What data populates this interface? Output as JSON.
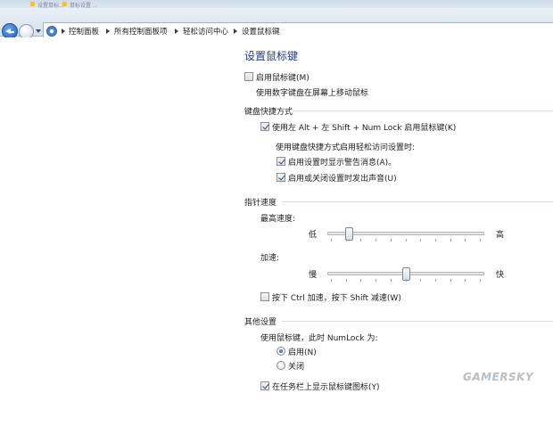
{
  "tabs_strip": [
    "设置鼠标...",
    "鼠标设置 ..."
  ],
  "address_bar": {
    "breadcrumbs": [
      "控制面板",
      "所有控制面板项",
      "轻松访问中心",
      "设置鼠标键"
    ]
  },
  "page": {
    "title": "设置鼠标键",
    "enable_mouse_keys": {
      "label": "启用鼠标键(M)",
      "checked": false
    },
    "enable_description": "使用数字键盘在屏幕上移动鼠标",
    "keyboard_shortcut": {
      "heading": "键盘快捷方式",
      "shortcut_option": {
        "label": "使用左 Alt + 左 Shift + Num Lock 启用鼠标键(K)",
        "checked": true
      },
      "subheading": "使用键盘快捷方式启用轻松访问设置时:",
      "warning_option": {
        "label": "启用设置时显示警告消息(A)。",
        "checked": true
      },
      "sound_option": {
        "label": "启用或关闭设置时发出声音(U)",
        "checked": true
      }
    },
    "pointer_speed": {
      "heading": "指针速度",
      "top_speed": {
        "label": "最高速度:",
        "min_label": "低",
        "max_label": "高",
        "value": 0.12
      },
      "acceleration": {
        "label": "加速:",
        "min_label": "慢",
        "max_label": "快",
        "value": 0.5
      },
      "ctrl_shift_option": {
        "label": "按下 Ctrl 加速，按下 Shift 减速(W)",
        "checked": false
      }
    },
    "other_settings": {
      "heading": "其他设置",
      "numlock_prompt": "使用鼠标键，此时 NumLock 为:",
      "radio_on": {
        "label": "启用(N)",
        "selected": true
      },
      "radio_off": {
        "label": "关闭",
        "selected": false
      },
      "taskbar_icon_option": {
        "label": "在任务栏上显示鼠标键图标(Y)",
        "checked": true
      }
    }
  },
  "watermark": "GAMERSKY",
  "colors": {
    "title": "#1e3c88",
    "accent": "#1d5fb7"
  }
}
